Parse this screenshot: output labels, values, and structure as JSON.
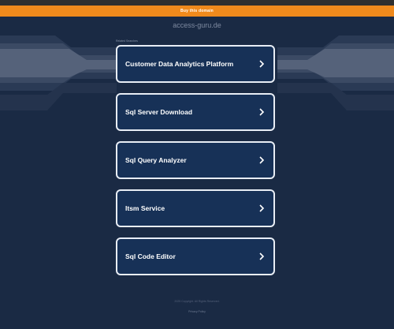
{
  "banner": {
    "label": "Buy this domain"
  },
  "header": {
    "domain": "access-guru.de"
  },
  "section": {
    "title": "Related Searches"
  },
  "tiles": [
    {
      "label": "Customer Data Analytics Platform"
    },
    {
      "label": "Sql Server Download"
    },
    {
      "label": "Sql Query Analyzer"
    },
    {
      "label": "Itsm Service"
    },
    {
      "label": "Sql Code Editor"
    }
  ],
  "footer": {
    "copyright": "2025 Copyright. All Rights Reserved.",
    "privacy": "Privacy Policy"
  },
  "colors": {
    "background": "#1a2a44",
    "banner": "#f08a1c",
    "tile_border": "#e8edf5",
    "tile_fill": "#173157"
  },
  "icons": {
    "tile_arrow": "chevron-right-icon"
  }
}
